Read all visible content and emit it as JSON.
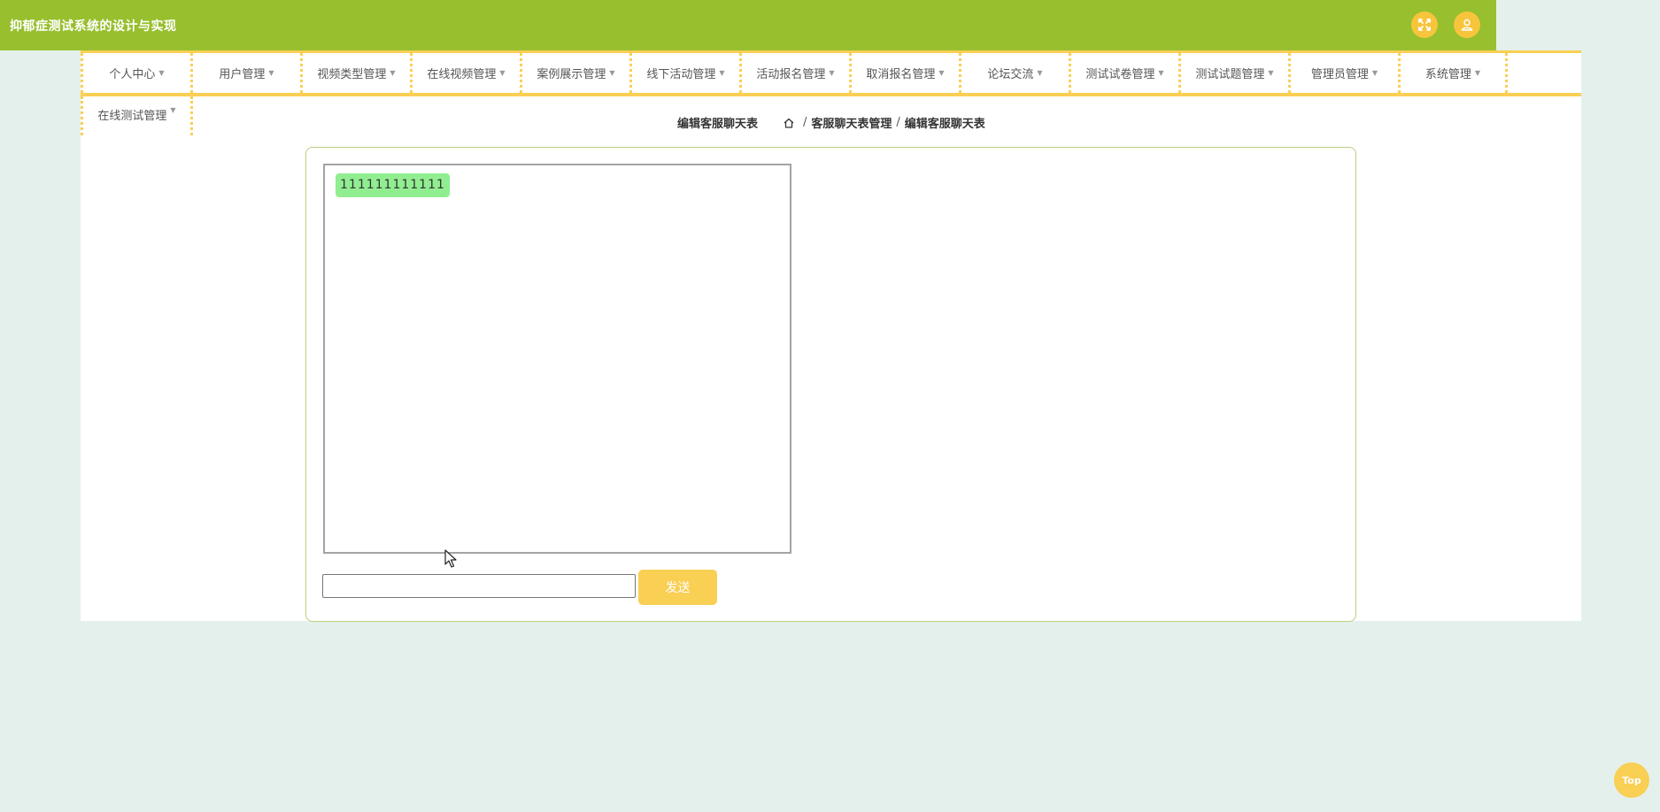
{
  "header": {
    "title": "抑郁症测试系统的设计与实现",
    "icons": {
      "fullscreen": "fullscreen-icon",
      "user": "user-icon"
    }
  },
  "nav": {
    "items": [
      {
        "label": "个人中心"
      },
      {
        "label": "用户管理"
      },
      {
        "label": "视频类型管理"
      },
      {
        "label": "在线视频管理"
      },
      {
        "label": "案例展示管理"
      },
      {
        "label": "线下活动管理"
      },
      {
        "label": "活动报名管理"
      },
      {
        "label": "取消报名管理"
      },
      {
        "label": "论坛交流"
      },
      {
        "label": "测试试卷管理"
      },
      {
        "label": "测试试题管理"
      },
      {
        "label": "管理员管理"
      },
      {
        "label": "系统管理"
      }
    ],
    "row2": [
      {
        "label": "在线测试管理"
      }
    ]
  },
  "page": {
    "title": "编辑客服聊天表",
    "breadcrumb": {
      "home_icon": "home-icon",
      "items": [
        "客服聊天表管理",
        "编辑客服聊天表"
      ],
      "separator": "/"
    }
  },
  "chat": {
    "messages": [
      {
        "text": "111111111111"
      }
    ],
    "input_value": "",
    "send_label": "发送"
  },
  "back_to_top": {
    "label": "Top"
  },
  "colors": {
    "header_bg": "#97bf2e",
    "accent": "#f9cf54",
    "page_bg": "#e4f0ec",
    "bubble": "#90ee90",
    "panel_border": "#b8cf7e"
  }
}
